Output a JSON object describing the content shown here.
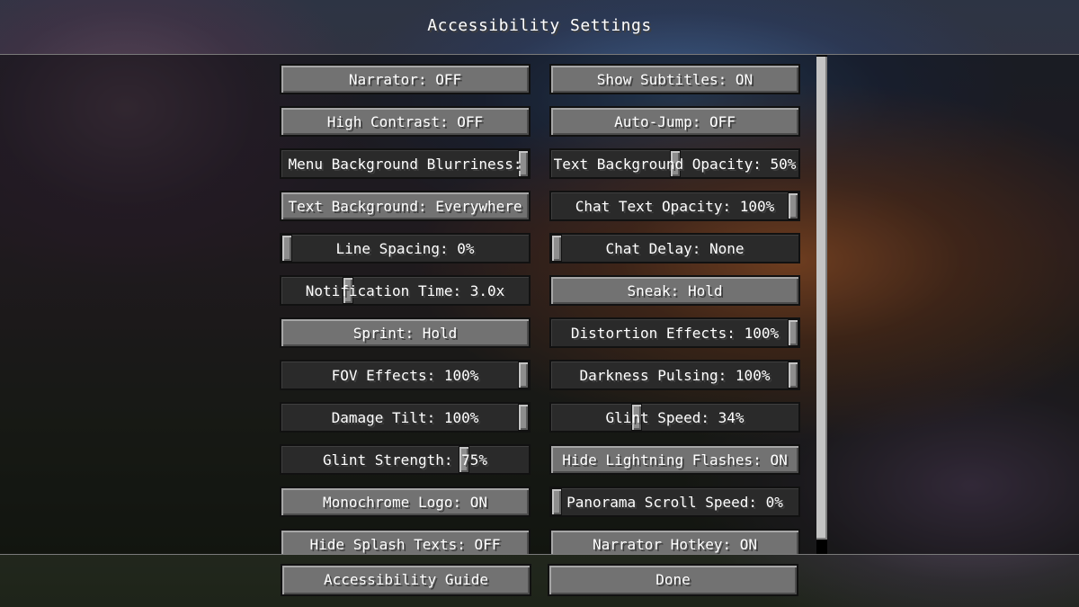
{
  "screen": {
    "title": "Accessibility Settings"
  },
  "options": [
    {
      "id": "narrator",
      "kind": "button",
      "label": "Narrator: OFF"
    },
    {
      "id": "show-subtitles",
      "kind": "button",
      "label": "Show Subtitles: ON"
    },
    {
      "id": "high-contrast",
      "kind": "button",
      "label": "High Contrast: OFF"
    },
    {
      "id": "auto-jump",
      "kind": "button",
      "label": "Auto-Jump: OFF"
    },
    {
      "id": "menu-background-blurriness",
      "kind": "slider",
      "label": "Menu Background Blurriness:",
      "value": 1.0
    },
    {
      "id": "text-background-opacity",
      "kind": "slider",
      "label": "Text Background Opacity: 50%",
      "value": 0.5
    },
    {
      "id": "text-background",
      "kind": "button",
      "label": "Text Background: Everywhere"
    },
    {
      "id": "chat-text-opacity",
      "kind": "slider",
      "label": "Chat Text Opacity: 100%",
      "value": 1.0
    },
    {
      "id": "line-spacing",
      "kind": "slider",
      "label": "Line Spacing: 0%",
      "value": 0.0
    },
    {
      "id": "chat-delay",
      "kind": "slider",
      "label": "Chat Delay: None",
      "value": 0.0
    },
    {
      "id": "notification-time",
      "kind": "slider",
      "label": "Notification Time: 3.0x",
      "value": 0.26
    },
    {
      "id": "sneak",
      "kind": "button",
      "label": "Sneak: Hold"
    },
    {
      "id": "sprint",
      "kind": "button",
      "label": "Sprint: Hold"
    },
    {
      "id": "distortion-effects",
      "kind": "slider",
      "label": "Distortion Effects: 100%",
      "value": 1.0
    },
    {
      "id": "fov-effects",
      "kind": "slider",
      "label": "FOV Effects: 100%",
      "value": 1.0
    },
    {
      "id": "darkness-pulsing",
      "kind": "slider",
      "label": "Darkness Pulsing: 100%",
      "value": 1.0
    },
    {
      "id": "damage-tilt",
      "kind": "slider",
      "label": "Damage Tilt: 100%",
      "value": 1.0
    },
    {
      "id": "glint-speed",
      "kind": "slider",
      "label": "Glint Speed: 34%",
      "value": 0.34
    },
    {
      "id": "glint-strength",
      "kind": "slider",
      "label": "Glint Strength: 75%",
      "value": 0.75
    },
    {
      "id": "hide-lightning-flashes",
      "kind": "button",
      "label": "Hide Lightning Flashes: ON"
    },
    {
      "id": "monochrome-logo",
      "kind": "button",
      "label": "Monochrome Logo: ON"
    },
    {
      "id": "panorama-scroll-speed",
      "kind": "slider",
      "label": "Panorama Scroll Speed: 0%",
      "value": 0.0
    },
    {
      "id": "hide-splash-texts",
      "kind": "button",
      "label": "Hide Splash Texts: OFF"
    },
    {
      "id": "narrator-hotkey",
      "kind": "button",
      "label": "Narrator Hotkey: ON"
    }
  ],
  "footer": {
    "guide_label": "Accessibility Guide",
    "done_label": "Done"
  },
  "colors": {
    "button_face": "#727272",
    "slider_track": "#2a2a2a",
    "text": "#ffffff"
  }
}
